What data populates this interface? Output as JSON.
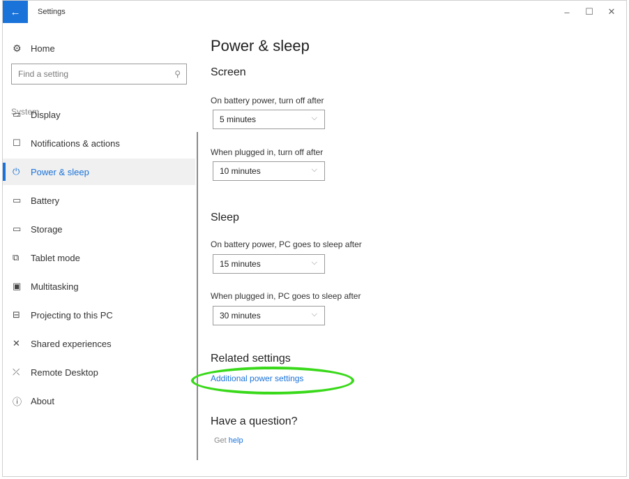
{
  "window": {
    "title": "Settings",
    "back_icon": "arrow-left-icon",
    "controls": {
      "minimize": "–",
      "maximize": "☐",
      "close": "✕"
    }
  },
  "sidebar": {
    "home_label": "Home",
    "home_icon": "gear-icon",
    "search": {
      "placeholder": "Find a setting"
    },
    "group_label": "System",
    "items": [
      {
        "label": "Display",
        "icon": "monitor-icon",
        "glyph": "▭"
      },
      {
        "label": "Notifications & actions",
        "icon": "message-icon",
        "glyph": "☐"
      },
      {
        "label": "Power & sleep",
        "icon": "power-icon",
        "glyph": "⏻",
        "selected": true
      },
      {
        "label": "Battery",
        "icon": "battery-icon",
        "glyph": "▭"
      },
      {
        "label": "Storage",
        "icon": "storage-icon",
        "glyph": "▭"
      },
      {
        "label": "Tablet mode",
        "icon": "tablet-mode-icon",
        "glyph": "⧉"
      },
      {
        "label": "Multitasking",
        "icon": "multitasking-icon",
        "glyph": "▣"
      },
      {
        "label": "Projecting to this PC",
        "icon": "projecting-icon",
        "glyph": "⊟"
      },
      {
        "label": "Shared experiences",
        "icon": "shared-experiences-icon",
        "glyph": "✕"
      },
      {
        "label": "Remote Desktop",
        "icon": "remote-desktop-icon",
        "glyph": "⤫"
      },
      {
        "label": "About",
        "icon": "info-icon",
        "glyph": "ⓘ"
      }
    ]
  },
  "main": {
    "title": "Power & sleep",
    "screen": {
      "heading": "Screen",
      "battery_label": "On battery power, turn off after",
      "battery_value": "5 minutes",
      "plugged_label": "When plugged in, turn off after",
      "plugged_value": "10 minutes"
    },
    "sleep": {
      "heading": "Sleep",
      "battery_label": "On battery power, PC goes to sleep after",
      "battery_value": "15 minutes",
      "plugged_label": "When plugged in, PC goes to sleep after",
      "plugged_value": "30 minutes"
    },
    "related": {
      "heading": "Related settings",
      "link": "Additional power settings"
    },
    "question": {
      "heading": "Have a question?",
      "get": "Get",
      "help": "help"
    }
  },
  "colors": {
    "accent": "#1a73d9",
    "highlight": "#39d91a"
  }
}
